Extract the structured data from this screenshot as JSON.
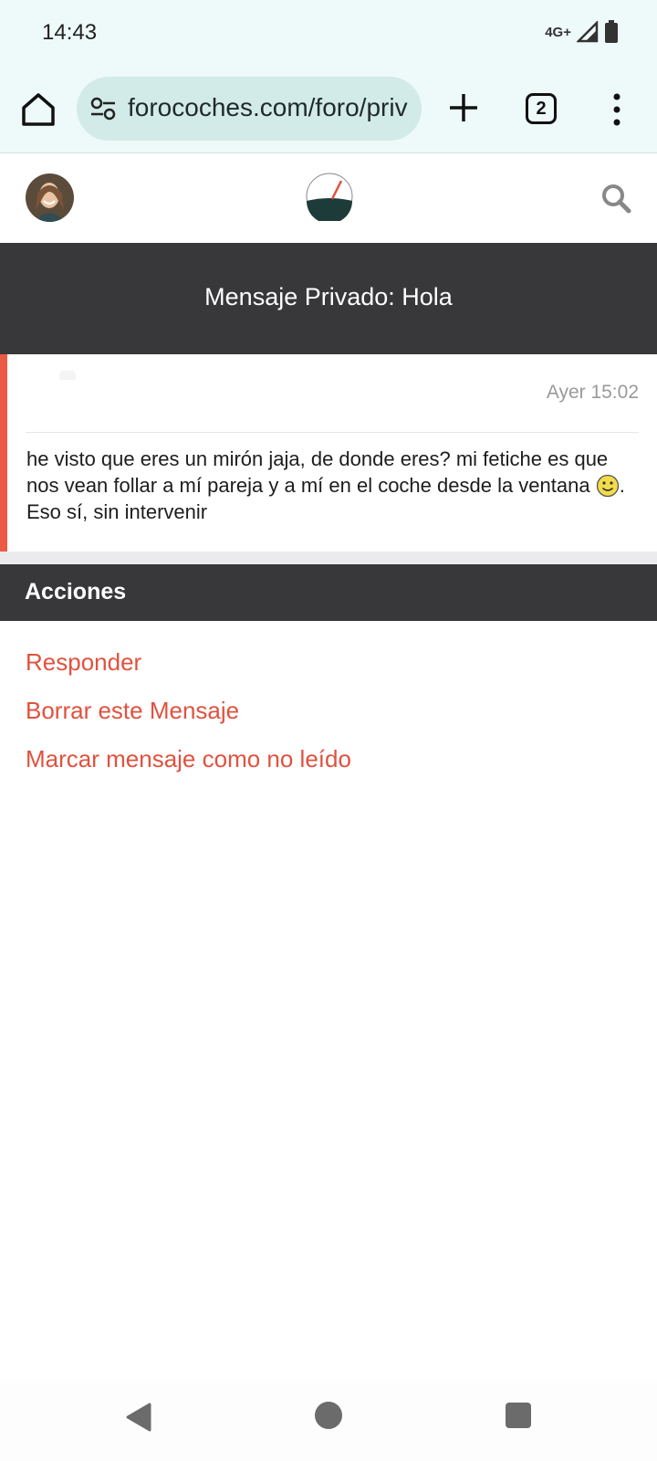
{
  "status_bar": {
    "time": "14:43",
    "network": "4G+"
  },
  "browser": {
    "url": "forocoches.com/foro/priv",
    "tab_count": "2"
  },
  "header": {
    "avatar_icon": "user-avatar",
    "logo_icon": "forocoches-logo",
    "search_icon": "search-icon"
  },
  "page": {
    "title": "Mensaje Privado: Hola"
  },
  "message": {
    "date": "Ayer 15:02",
    "body_part1": "he visto que eres un mirón jaja, de donde eres? mi fetiche es que nos vean follar a mí pareja y a mí en el coche desde la ventana ",
    "body_part2": ". Eso sí, sin intervenir"
  },
  "actions": {
    "header": "Acciones",
    "reply": "Responder",
    "delete": "Borrar este Mensaje",
    "mark_unread": "Marcar mensaje como no leído"
  },
  "colors": {
    "accent": "#e0523f",
    "band": "#38373a",
    "browser_bg": "#eefaf9"
  }
}
